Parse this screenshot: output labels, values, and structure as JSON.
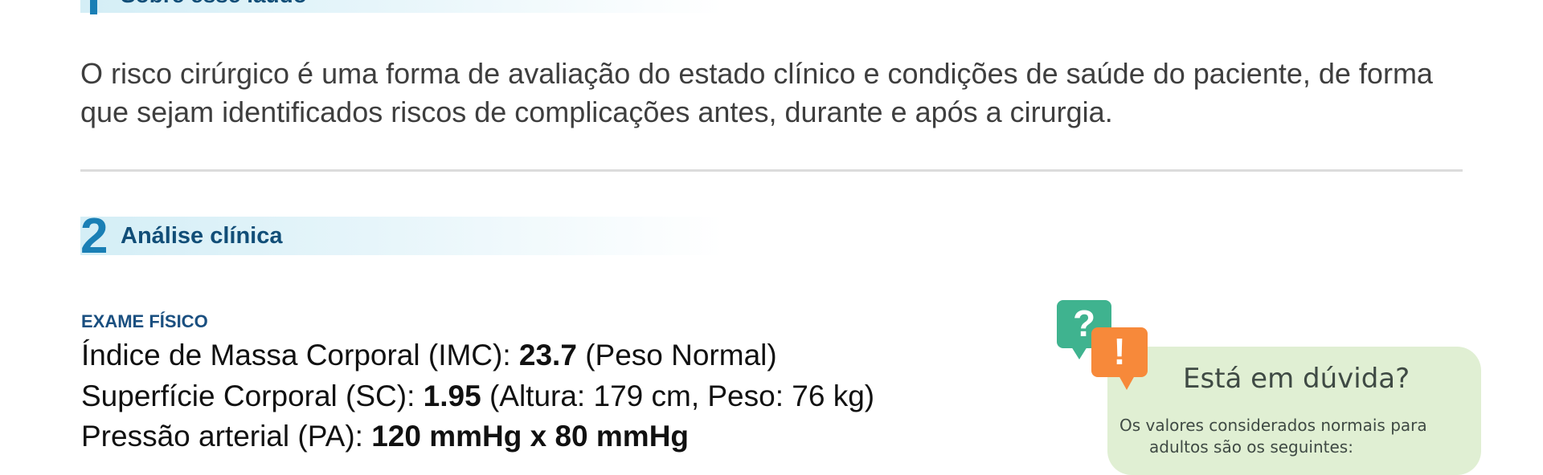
{
  "section1": {
    "title": "Sobre esse laudo"
  },
  "intro": {
    "paragraph": "O risco cirúrgico é uma forma de avaliação do estado clínico e condições de saúde do paciente, de forma que sejam identificados riscos de complicações antes, durante e após a cirurgia."
  },
  "section2": {
    "number": "2",
    "title": "Análise clínica"
  },
  "exam": {
    "label": "EXAME FÍSICO",
    "imc": {
      "prefix": "Índice de Massa Corporal (IMC): ",
      "value": "23.7",
      "suffix": " (Peso Normal)"
    },
    "sc": {
      "prefix": "Superfície Corporal (SC): ",
      "value": "1.95",
      "suffix": " (Altura: 179 cm, Peso: 76 kg)"
    },
    "pa": {
      "prefix": "Pressão arterial (PA): ",
      "value": "120 mmHg x 80 mmHg"
    }
  },
  "help": {
    "title": "Está em dúvida?",
    "text": "Os valores considerados normais para",
    "text2": "adultos são os seguintes:",
    "question_glyph": "?",
    "exclaim_glyph": "!",
    "colors": {
      "question": "#3fb38f",
      "exclaim": "#f7893a",
      "card": "#e0efd3"
    }
  }
}
